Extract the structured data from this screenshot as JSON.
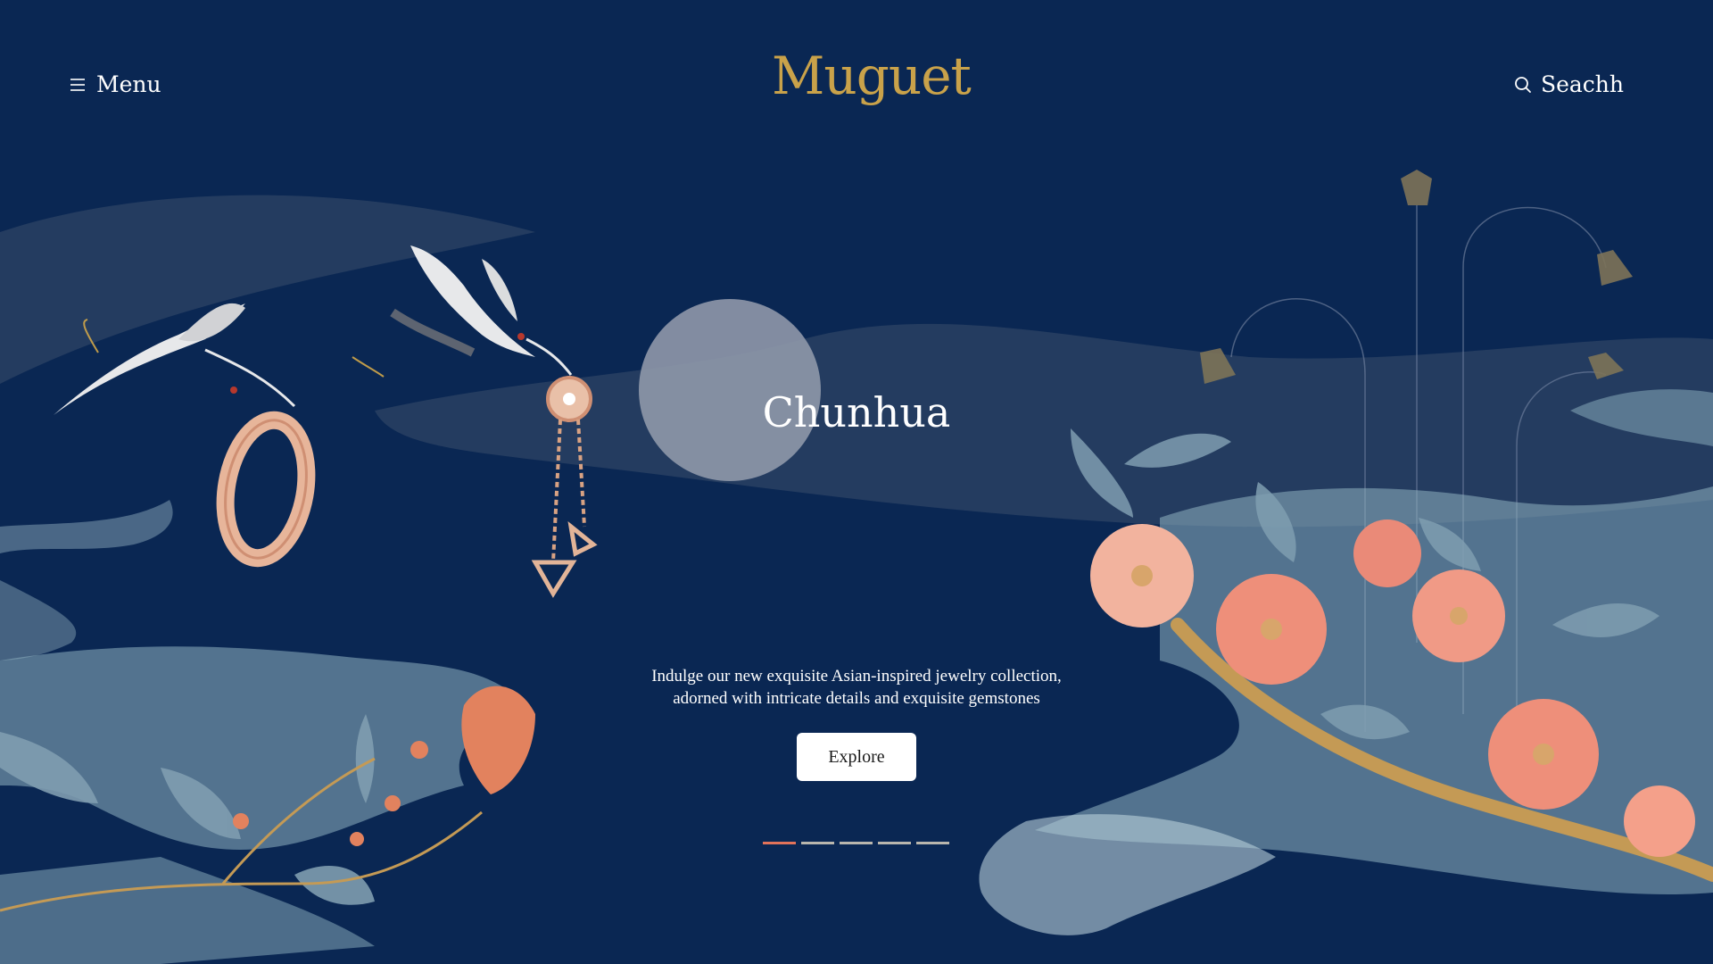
{
  "header": {
    "menu_label": "Menu",
    "search_label": "Seachh",
    "logo_text": "Muguet"
  },
  "hero": {
    "title": "Chunhua",
    "description_line1": "Indulge our new exquisite Asian-inspired jewelry collection,",
    "description_line2": "adorned with intricate details and exquisite gemstones",
    "cta_label": "Explore"
  },
  "carousel": {
    "slide_count": 5,
    "active_index": 0
  },
  "colors": {
    "background": "#0a2753",
    "gold": "#c9a24a",
    "accent": "#e2735a",
    "indicator": "#b9b6ad"
  },
  "icons": {
    "menu": "hamburger-icon",
    "search": "search-icon"
  }
}
